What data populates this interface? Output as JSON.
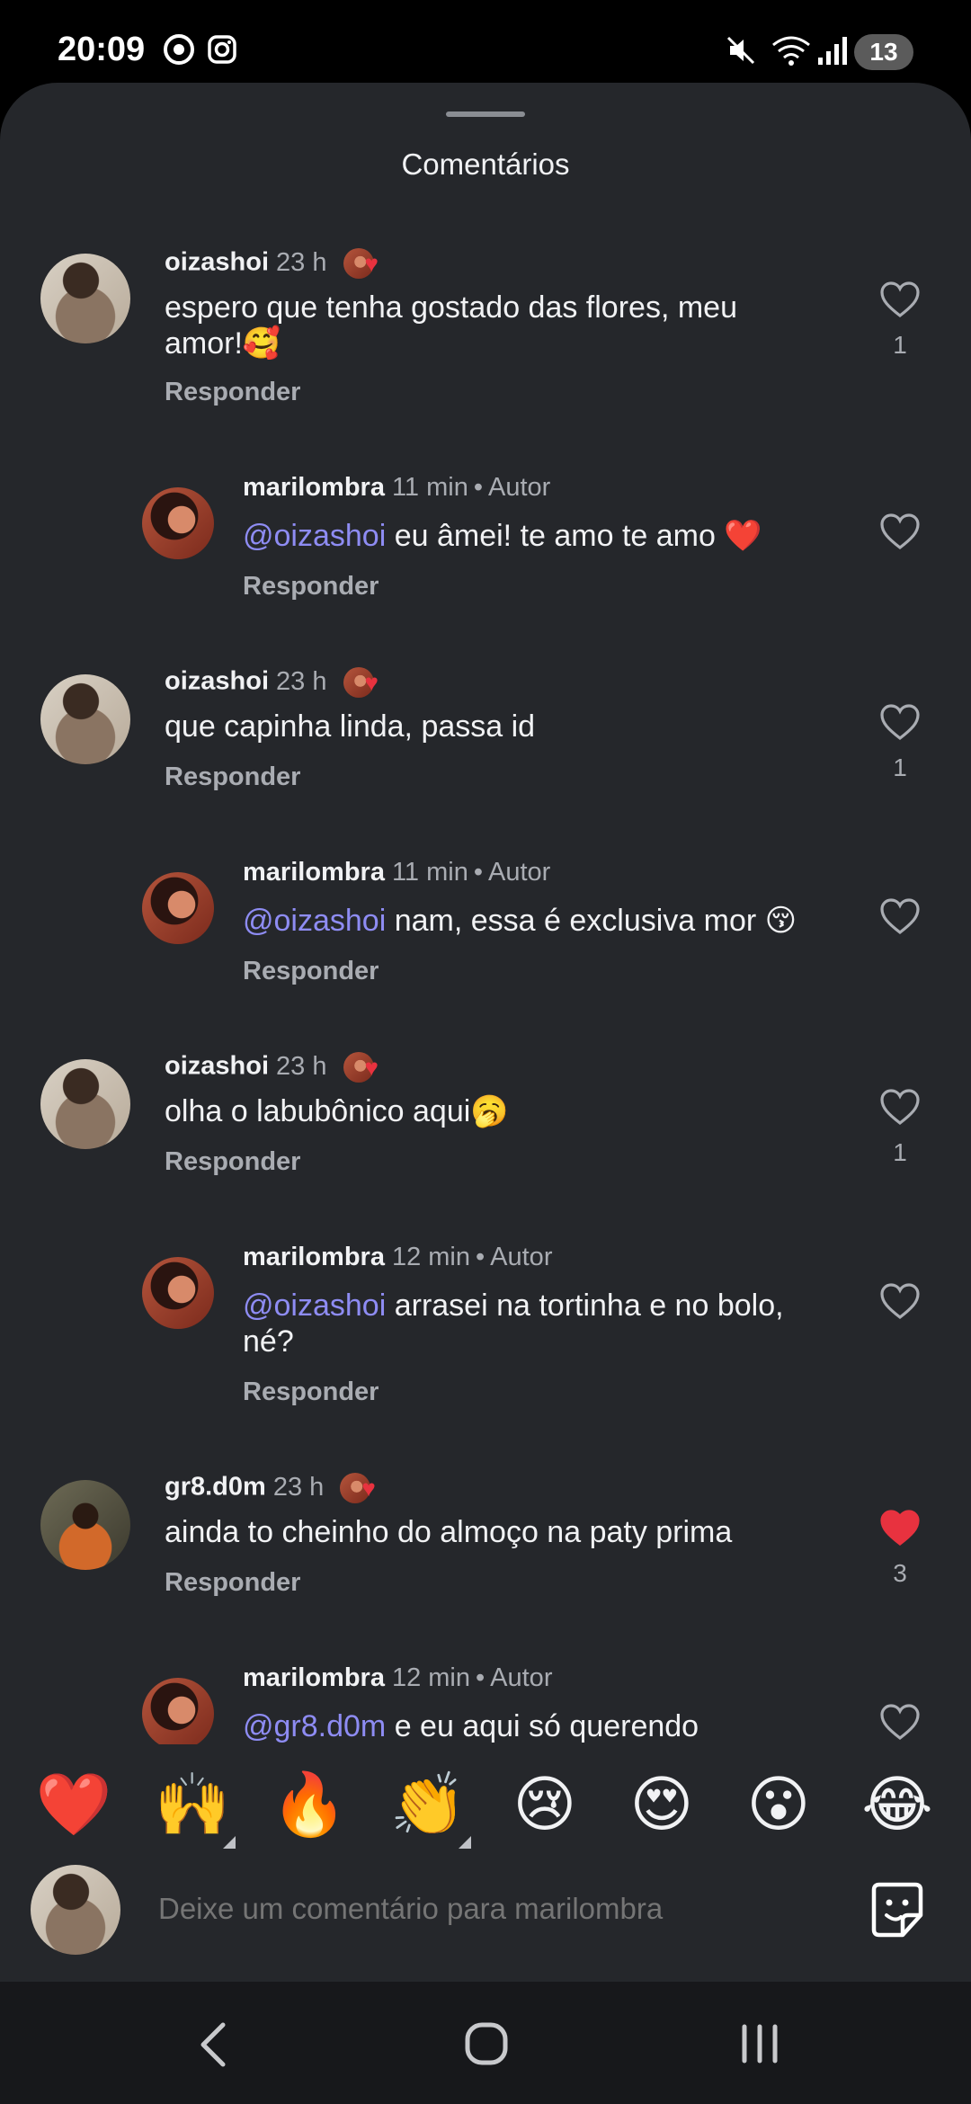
{
  "status_bar": {
    "time": "20:09",
    "notification_count": "13"
  },
  "sheet": {
    "title": "Comentários"
  },
  "comments": [
    {
      "user": "oizashoi",
      "time": "23 h",
      "author_label": "",
      "mention": "",
      "text": "espero que tenha gostado das flores, meu amor!🥰",
      "reply_label": "Responder",
      "likes": "1",
      "liked": false,
      "avatar": "oiza"
    },
    {
      "user": "marilombra",
      "time": "11 min",
      "author_label": "Autor",
      "mention": "@oizashoi",
      "text": " eu âmei! te amo te amo ❤️",
      "reply_label": "Responder",
      "likes": "",
      "liked": false,
      "avatar": "mari"
    },
    {
      "user": "oizashoi",
      "time": "23 h",
      "author_label": "",
      "mention": "",
      "text": "que capinha linda, passa id",
      "reply_label": "Responder",
      "likes": "1",
      "liked": false,
      "avatar": "oiza"
    },
    {
      "user": "marilombra",
      "time": "11 min",
      "author_label": "Autor",
      "mention": "@oizashoi",
      "text": " nam, essa é exclusiva mor 😚",
      "reply_label": "Responder",
      "likes": "",
      "liked": false,
      "avatar": "mari"
    },
    {
      "user": "oizashoi",
      "time": "23 h",
      "author_label": "",
      "mention": "",
      "text": "olha o labubônico aqui🥱",
      "reply_label": "Responder",
      "likes": "1",
      "liked": false,
      "avatar": "oiza"
    },
    {
      "user": "marilombra",
      "time": "12 min",
      "author_label": "Autor",
      "mention": "@oizashoi",
      "text": " arrasei na tortinha e no bolo, né?",
      "reply_label": "Responder",
      "likes": "",
      "liked": false,
      "avatar": "mari"
    },
    {
      "user": "gr8.d0m",
      "time": "23 h",
      "author_label": "",
      "mention": "",
      "text": "ainda to cheinho do almoço na paty prima",
      "reply_label": "Responder",
      "likes": "3",
      "liked": true,
      "avatar": "gr8"
    },
    {
      "user": "marilombra",
      "time": "12 min",
      "author_label": "Autor",
      "mention": "@gr8.d0m",
      "text": " e eu aqui só querendo",
      "reply_label": "",
      "likes": "",
      "liked": false,
      "avatar": "mari"
    }
  ],
  "author_separator": "•",
  "reactions": [
    "❤️",
    "🙌",
    "🔥",
    "👏",
    "😢",
    "😍",
    "😮",
    "😂"
  ],
  "comment_input": {
    "placeholder": "Deixe um comentário para marilombra"
  },
  "icons": {
    "heart_outline": "heart-outline-icon",
    "heart_filled": "heart-filled-icon",
    "sticker": "sticker-icon",
    "nav_back": "back-icon",
    "nav_home": "home-icon",
    "nav_recents": "recents-icon"
  },
  "colors": {
    "background": "#25272b",
    "mention": "#8e8cf3",
    "like_red": "#e8323f",
    "muted_text": "#a9acb2"
  }
}
